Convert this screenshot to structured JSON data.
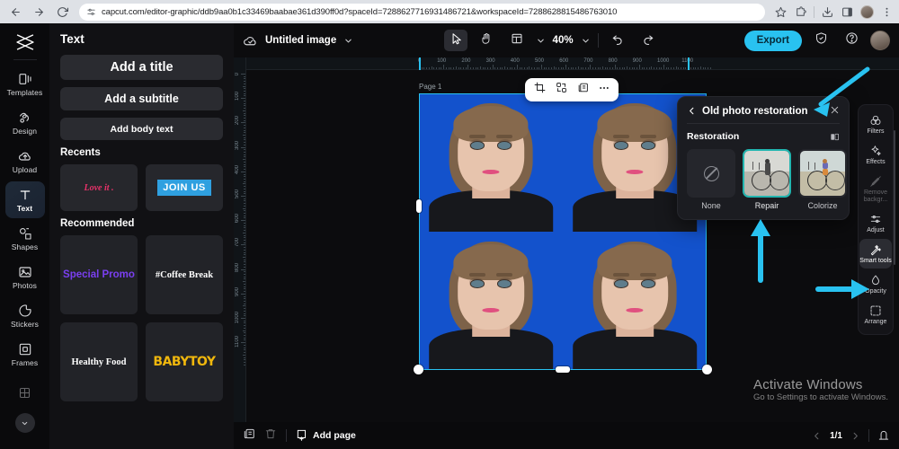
{
  "browser": {
    "url": "capcut.com/editor-graphic/ddb9aa0b1c33469baabae361d390ff0d?spaceId=7288627716931486721&workspaceId=7288628815486763010",
    "back_icon": "back-arrow-icon",
    "forward_icon": "forward-arrow-icon",
    "reload_icon": "reload-icon",
    "site_settings_icon": "tune-icon",
    "bookmark_icon": "star-icon",
    "extensions_icon": "extensions-icon",
    "downloads_icon": "download-icon",
    "sidepanel_icon": "side-panel-icon",
    "profile_icon": "profile-avatar-icon",
    "menu_icon": "kebab-menu-icon"
  },
  "rail": {
    "logo": "capcut-logo-icon",
    "items": [
      {
        "label": "Templates",
        "icon": "templates-icon",
        "active": false
      },
      {
        "label": "Design",
        "icon": "design-icon",
        "active": false
      },
      {
        "label": "Upload",
        "icon": "upload-cloud-icon",
        "active": false
      },
      {
        "label": "Text",
        "icon": "text-icon",
        "active": true
      },
      {
        "label": "Shapes",
        "icon": "shapes-icon",
        "active": false
      },
      {
        "label": "Photos",
        "icon": "photo-icon",
        "active": false
      },
      {
        "label": "Stickers",
        "icon": "sticker-icon",
        "active": false
      },
      {
        "label": "Frames",
        "icon": "frame-icon",
        "active": false
      }
    ],
    "collapse_icon": "chevron-down-icon"
  },
  "text_panel": {
    "title": "Text",
    "add_title": "Add a title",
    "add_subtitle": "Add a subtitle",
    "add_body": "Add body text",
    "recents_header": "Recents",
    "recents": [
      {
        "label": "Love it .",
        "style": "loveit"
      },
      {
        "label": "JOIN US",
        "style": "joinus"
      }
    ],
    "recommended_header": "Recommended",
    "recommended": [
      {
        "label": "Special Promo",
        "style": "promo"
      },
      {
        "label": "#Coffee Break",
        "style": "coffee"
      },
      {
        "label": "Healthy Food",
        "style": "health"
      },
      {
        "label": "BABYTOY",
        "style": "baby"
      }
    ]
  },
  "topbar": {
    "cloud_icon": "cloud-saved-icon",
    "doc_name": "Untitled image",
    "doc_chevron": "chevron-down-icon",
    "select_tool_icon": "cursor-select-icon",
    "hand_tool_icon": "hand-pan-icon",
    "layout_tool_icon": "layout-icon",
    "layout_chevron": "chevron-down-icon",
    "zoom_level": "40%",
    "zoom_chevron": "chevron-down-icon",
    "undo_icon": "undo-icon",
    "redo_icon": "redo-icon",
    "export_label": "Export",
    "shield_icon": "shield-icon",
    "help_icon": "help-circle-icon",
    "avatar": "user-avatar"
  },
  "canvas": {
    "page_label": "Page 1",
    "artboard_color": "#1352cc",
    "ruler_h_ticks": [
      "0",
      "100",
      "200",
      "300",
      "400",
      "500",
      "600",
      "700",
      "800",
      "900",
      "1000",
      "1100"
    ],
    "ruler_v_ticks": [
      "0",
      "100",
      "200",
      "300",
      "400",
      "500",
      "600",
      "700",
      "800",
      "900",
      "1000",
      "1100"
    ],
    "float_toolbar": [
      {
        "icon": "crop-icon"
      },
      {
        "icon": "replace-media-icon"
      },
      {
        "icon": "duplicate-icon"
      },
      {
        "icon": "more-options-icon"
      }
    ]
  },
  "restoration_panel": {
    "back_icon": "chevron-left-icon",
    "title": "Old photo restoration",
    "close_icon": "close-icon",
    "section_label": "Restoration",
    "compare_icon": "compare-icon",
    "options": [
      {
        "label": "None",
        "selected": false,
        "kind": "none"
      },
      {
        "label": "Repair",
        "selected": true,
        "kind": "bw"
      },
      {
        "label": "Colorize",
        "selected": false,
        "kind": "color"
      }
    ]
  },
  "right_rail": {
    "items": [
      {
        "label": "Filters",
        "icon": "filters-icon",
        "active": false
      },
      {
        "label": "Effects",
        "icon": "effects-icon",
        "active": false
      },
      {
        "label": "Remove backgr...",
        "icon": "remove-bg-icon",
        "active": false,
        "dim": true
      },
      {
        "label": "Adjust",
        "icon": "adjust-sliders-icon",
        "active": false
      },
      {
        "label": "Smart tools",
        "icon": "smart-tools-icon",
        "active": true
      },
      {
        "label": "Opacity",
        "icon": "opacity-drop-icon",
        "active": false
      },
      {
        "label": "Arrange",
        "icon": "arrange-icon",
        "active": false
      }
    ]
  },
  "bottombar": {
    "duplicate_icon": "duplicate-page-icon",
    "delete_icon": "trash-icon",
    "add_page_icon": "add-page-icon",
    "add_page_label": "Add page",
    "prev_icon": "chevron-left-icon",
    "page_indicator": "1/1",
    "next_icon": "chevron-right-icon",
    "pages_panel_icon": "pages-panel-icon"
  },
  "watermark": {
    "line1": "Activate Windows",
    "line2": "Go to Settings to activate Windows."
  },
  "annotations": {
    "accent": "#29c2f0",
    "arrow_to_title": "arrow-pointing-to-panel-title",
    "arrow_to_repair": "arrow-pointing-to-repair-option",
    "arrow_to_smart_tools": "arrow-pointing-to-smart-tools"
  }
}
